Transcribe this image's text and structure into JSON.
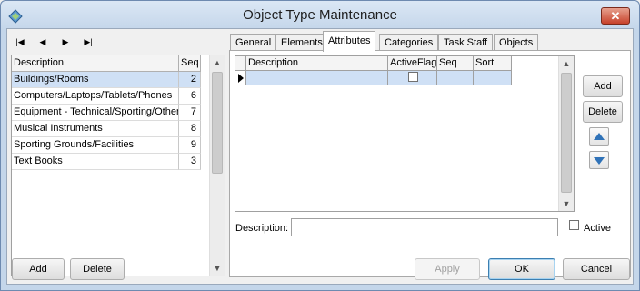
{
  "window": {
    "title": "Object Type Maintenance",
    "close_label": "✕"
  },
  "nav": {
    "first": "|◀",
    "prev": "◀",
    "next": "▶",
    "last": "▶|"
  },
  "list": {
    "headers": {
      "description": "Description",
      "seq": "Seq"
    },
    "rows": [
      {
        "description": "Buildings/Rooms",
        "seq": "2"
      },
      {
        "description": "Computers/Laptops/Tablets/Phones",
        "seq": "6"
      },
      {
        "description": "Equipment - Technical/Sporting/Other",
        "seq": "7"
      },
      {
        "description": "Musical Instruments",
        "seq": "8"
      },
      {
        "description": "Sporting Grounds/Facilities",
        "seq": "9"
      },
      {
        "description": "Text Books",
        "seq": "3"
      }
    ],
    "scroll_up": "▲",
    "scroll_down": "▼"
  },
  "tabs": [
    {
      "label": "General"
    },
    {
      "label": "Elements"
    },
    {
      "label": "Attributes"
    },
    {
      "label": "Categories"
    },
    {
      "label": "Task Staff"
    },
    {
      "label": "Objects"
    }
  ],
  "active_tab": "Attributes",
  "attributes": {
    "headers": {
      "description": "Description",
      "activeflag": "ActiveFlag",
      "seq": "Seq",
      "sort": "Sort"
    },
    "add_label": "Add",
    "delete_label": "Delete",
    "description_label": "Description:",
    "description_value": "",
    "active_label": "Active",
    "scroll_up": "▲",
    "scroll_down": "▼"
  },
  "footer": {
    "add_label": "Add",
    "delete_label": "Delete",
    "apply_label": "Apply",
    "ok_label": "OK",
    "cancel_label": "Cancel"
  },
  "colors": {
    "selection": "#cfe0f5",
    "titlebar": "#c4d6ea",
    "arrow_blue": "#2f72b8",
    "close_red": "#c7422b"
  }
}
